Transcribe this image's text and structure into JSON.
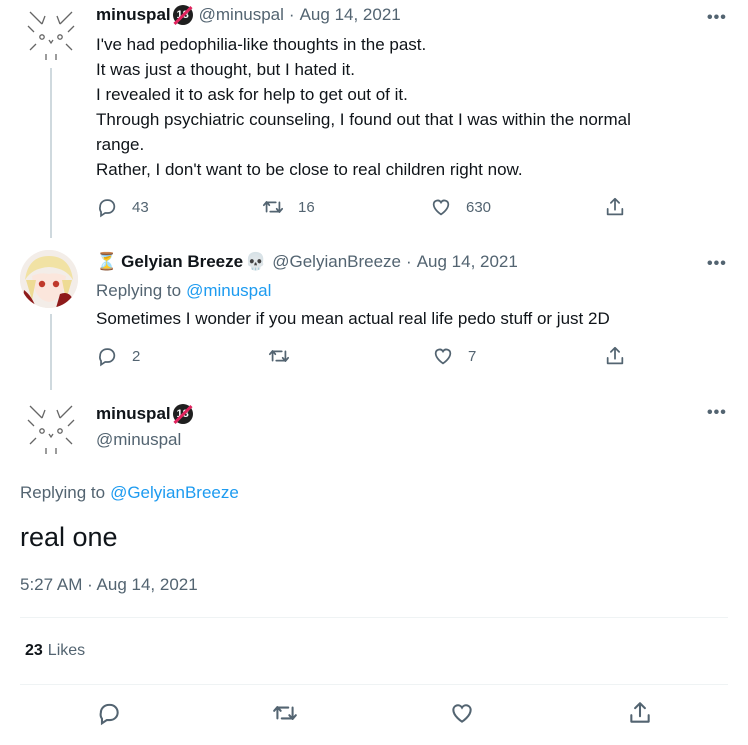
{
  "tweets": [
    {
      "display_name": "minuspal",
      "handle": "@minuspal",
      "date": "Aug 14, 2021",
      "lines": [
        "I've had pedophilia-like thoughts in the past.",
        "It was just a thought, but I hated it.",
        "I revealed it to ask for help to get out of it.",
        "Through psychiatric counseling, I found out that I was within the normal",
        "range.",
        "Rather, I don't want to be close to real children right now."
      ],
      "replies": "43",
      "retweets": "16",
      "likes": "630"
    },
    {
      "display_name": "Gelyian Breeze",
      "emoji_prefix": "⏳",
      "emoji_suffix": "💀",
      "handle": "@GelyianBreeze",
      "date": "Aug 14, 2021",
      "replying_prefix": "Replying to",
      "replying_to": "@minuspal",
      "text": "Sometimes I wonder if you mean actual real life pedo stuff or just 2D",
      "replies": "2",
      "likes": "7"
    }
  ],
  "main": {
    "display_name": "minuspal",
    "handle": "@minuspal",
    "replying_prefix": "Replying to",
    "replying_to": "@GelyianBreeze",
    "text": "real one",
    "timestamp": "5:27 AM · Aug 14, 2021",
    "likes_count": "23",
    "likes_label": "Likes"
  },
  "more_glyph": "•••",
  "badge_text": "18",
  "separator": "·",
  "colors": {
    "link": "#1d9bf0",
    "secondary": "#536471",
    "divider": "#eff3f4"
  }
}
